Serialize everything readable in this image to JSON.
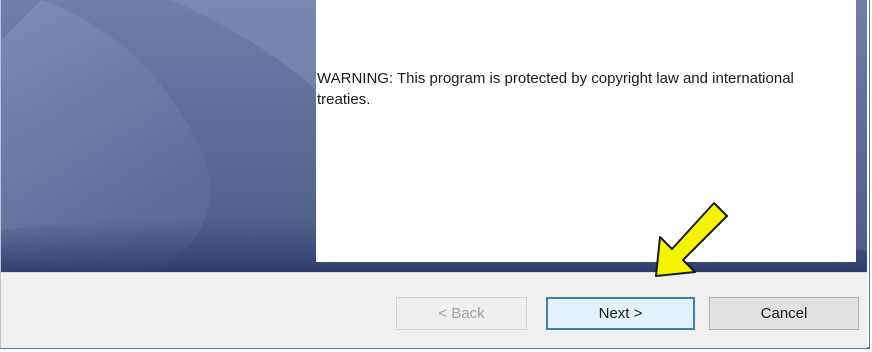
{
  "dialog": {
    "warning_text": "WARNING: This program is protected by copyright law and international treaties."
  },
  "buttons": {
    "back_label": "< Back",
    "back_enabled": false,
    "next_label": "Next >",
    "cancel_label": "Cancel"
  },
  "annotation": {
    "icon": "yellow-arrow-icon",
    "color": "#f5f500"
  },
  "colors": {
    "window_border": "#3d7ad1",
    "footer_bg": "#f0f0f0",
    "banner_blue": "#5e6d98"
  }
}
